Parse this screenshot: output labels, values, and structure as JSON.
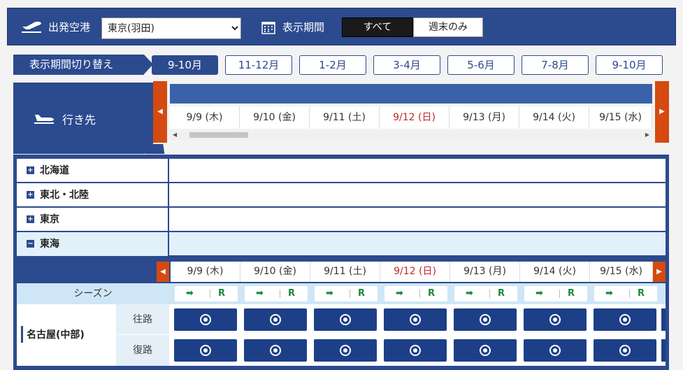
{
  "header": {
    "origin_label": "出発空港",
    "origin_value": "東京(羽田)",
    "period_label": "表示期間",
    "seg_all": "すべて",
    "seg_weekend": "週末のみ"
  },
  "period": {
    "label": "表示期間切り替え",
    "tabs": [
      "9-10月",
      "11-12月",
      "1-2月",
      "3-4月",
      "5-6月",
      "7-8月",
      "9-10月"
    ]
  },
  "destination": {
    "label": "行き先"
  },
  "dates": [
    "9/9 (木)",
    "9/10 (金)",
    "9/11 (土)",
    "9/12 (日)",
    "9/13 (月)",
    "9/14 (火)",
    "9/15 (水)"
  ],
  "regions": [
    "北海道",
    "東北・北陸",
    "東京",
    "東海"
  ],
  "season": {
    "label": "シーズン",
    "arrow": "➡",
    "r": "R"
  },
  "rows": {
    "city": "名古屋(中部)",
    "go": "往路",
    "back": "復路"
  },
  "colors": {
    "primary": "#2c4a8e",
    "accent": "#d44a10",
    "sunday": "#c0282b",
    "season_green": "#1a8a3a"
  }
}
